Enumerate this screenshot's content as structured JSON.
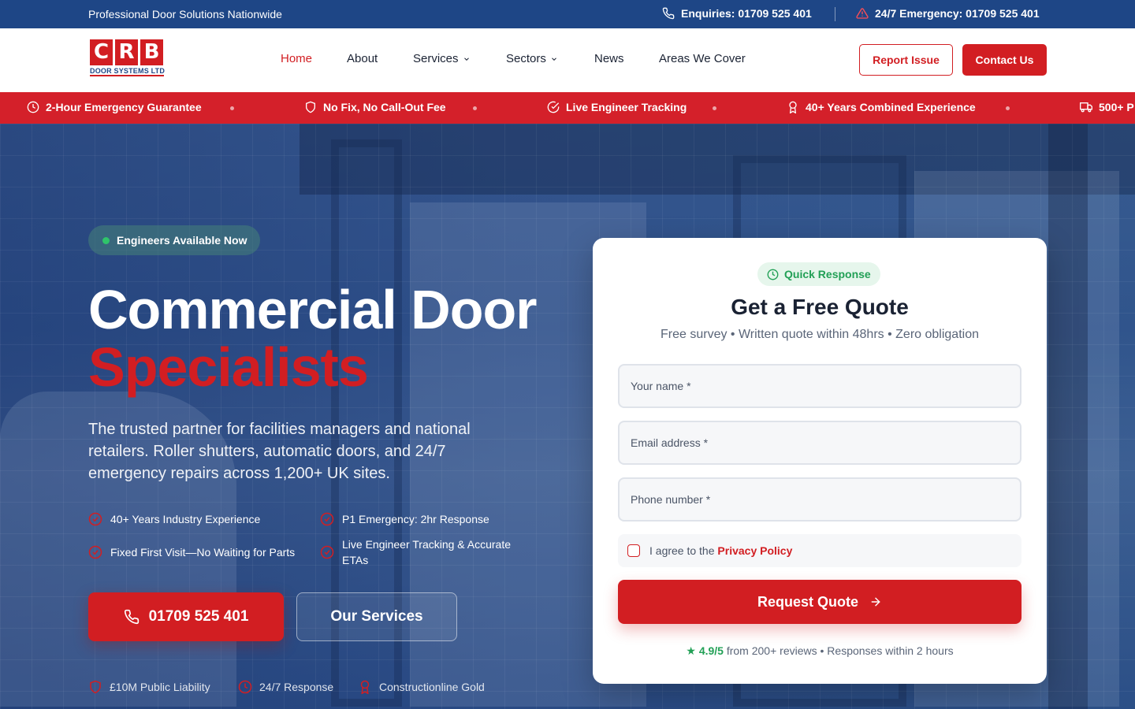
{
  "topbar": {
    "tagline": "Professional Door Solutions Nationwide",
    "enquiries": "Enquiries: 01709 525 401",
    "emergency": "24/7 Emergency: 01709 525 401"
  },
  "logo": {
    "letters": [
      "C",
      "R",
      "B"
    ],
    "subtitle": "DOOR SYSTEMS LTD"
  },
  "nav": {
    "home": "Home",
    "about": "About",
    "services": "Services",
    "sectors": "Sectors",
    "news": "News",
    "areas": "Areas We Cover"
  },
  "header_buttons": {
    "report": "Report Issue",
    "contact": "Contact Us"
  },
  "ticker": [
    {
      "icon": "clock-icon",
      "label": "2-Hour Emergency Guarantee"
    },
    {
      "icon": "shield-icon",
      "label": "No Fix, No Call-Out Fee"
    },
    {
      "icon": "check-circle-icon",
      "label": "Live Engineer Tracking"
    },
    {
      "icon": "award-icon",
      "label": "40+ Years Combined Experience"
    },
    {
      "icon": "truck-icon",
      "label": "500+ P"
    }
  ],
  "hero": {
    "badge": "Engineers Available Now",
    "heading_line1": "Commercial Door",
    "heading_line2": "Specialists",
    "lead": "The trusted partner for facilities managers and national retailers. Roller shutters, automatic doors, and 24/7 emergency repairs across 1,200+ UK sites.",
    "features": [
      "40+ Years Industry Experience",
      "P1 Emergency: 2hr Response",
      "Fixed First Visit—No Waiting for Parts",
      "Live Engineer Tracking & Accurate ETAs"
    ],
    "phone_button": "01709 525 401",
    "services_button": "Our Services",
    "trust": [
      {
        "icon": "shield-icon",
        "label": "£10M Public Liability"
      },
      {
        "icon": "clock-icon",
        "label": "24/7 Response"
      },
      {
        "icon": "award-icon",
        "label": "Constructionline Gold"
      }
    ]
  },
  "quote": {
    "badge": "Quick Response",
    "title": "Get a Free Quote",
    "subtitle": "Free survey • Written quote within 48hrs • Zero obligation",
    "name_placeholder": "Your name *",
    "email_placeholder": "Email address *",
    "phone_placeholder": "Phone number *",
    "agree_text": "I agree to the",
    "privacy_link": "Privacy Policy",
    "submit": "Request Quote",
    "rating": "★ 4.9/5",
    "reviews_text": "from 200+ reviews • Responses within 2 hours"
  },
  "colors": {
    "brand_red": "#d21e22",
    "brand_blue": "#1e4686",
    "success_green": "#22a056"
  }
}
